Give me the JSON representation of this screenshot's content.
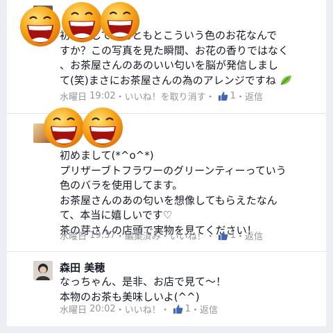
{
  "comments": [
    {
      "author": "",
      "lines": [
        "初めまして！もともとこういう色のお花なんで",
        "すか？この写真を見た瞬間、お花の香りではなく",
        "、お茶屋さんのあのいい匂いを脳が発信しまし",
        "て(笑)まさにお茶屋さんの為のアレンジですね"
      ],
      "meta": {
        "day": "水曜日",
        "time": "19:02",
        "actions": [
          "いいね！を取り消す"
        ],
        "likes": "1",
        "reply": "返信"
      },
      "trailing_icon": "leaf-emoji-icon"
    },
    {
      "author": "",
      "lines": [
        "初めまして(*^o^*)",
        "プリザーブトフラワーのグリーンティーっていう",
        "色のバラを使用してます。",
        "お茶屋さんのあの匂いを想像してもらえたなん",
        "て、本当に嬉しいです♡",
        "茶の芽さんの店頭で実物を見てください！"
      ],
      "meta": {
        "day": "水曜日",
        "time": "19:37",
        "actions": [
          "編集済み",
          "いいね！"
        ],
        "likes": "1",
        "reply": "返信"
      }
    },
    {
      "author": "森田 美穂",
      "lines": [
        "なっちゃん、是非、お店で見て〜！",
        "本物のお茶も美味しいよ(^^)"
      ],
      "meta": {
        "day": "水曜日",
        "time": "20:02",
        "actions": [
          "いいね！"
        ],
        "likes": "1",
        "reply": "返信"
      }
    }
  ],
  "colors": {
    "text": "#141823",
    "meta": "#90949c",
    "like_blue": "#4267b2",
    "background": "#eceef3",
    "smiley": "#f7a81b"
  }
}
